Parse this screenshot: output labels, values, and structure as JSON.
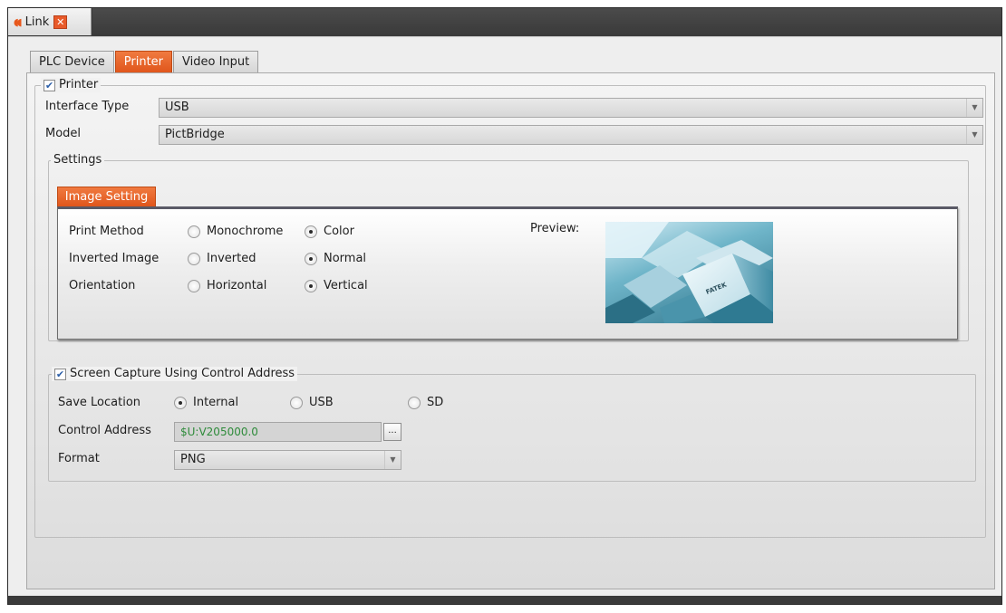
{
  "window": {
    "tab_label": "Link",
    "app_icon": "fatek-link-icon",
    "close_glyph": "✕"
  },
  "tabs": [
    {
      "label": "PLC Device",
      "active": false
    },
    {
      "label": "Printer",
      "active": true
    },
    {
      "label": "Video Input",
      "active": false
    }
  ],
  "printer": {
    "enabled_label": "Printer",
    "checked": true,
    "interface_type": {
      "label": "Interface Type",
      "value": "USB"
    },
    "model": {
      "label": "Model",
      "value": "PictBridge"
    },
    "settings_label": "Settings",
    "image_setting_tab": "Image Setting",
    "print_method": {
      "label": "Print Method",
      "options": [
        "Monochrome",
        "Color"
      ],
      "selected": "Color"
    },
    "inverted_image": {
      "label": "Inverted Image",
      "options": [
        "Inverted",
        "Normal"
      ],
      "selected": "Normal"
    },
    "orientation": {
      "label": "Orientation",
      "options": [
        "Horizontal",
        "Vertical"
      ],
      "selected": "Vertical"
    },
    "preview_label": "Preview:",
    "preview_logo_text": "FATEK"
  },
  "screen_capture": {
    "enabled_label": "Screen Capture Using Control Address",
    "checked": true,
    "save_location": {
      "label": "Save Location",
      "options": [
        "Internal",
        "USB",
        "SD"
      ],
      "selected": "Internal"
    },
    "control_address": {
      "label": "Control Address",
      "value": "$U:V205000.0",
      "browse_label": "..."
    },
    "format": {
      "label": "Format",
      "value": "PNG"
    }
  },
  "colors": {
    "accent": "#e8581c",
    "address_text": "#2e8b3a"
  },
  "icons": {
    "check": "✔",
    "dropdown": "▼"
  }
}
